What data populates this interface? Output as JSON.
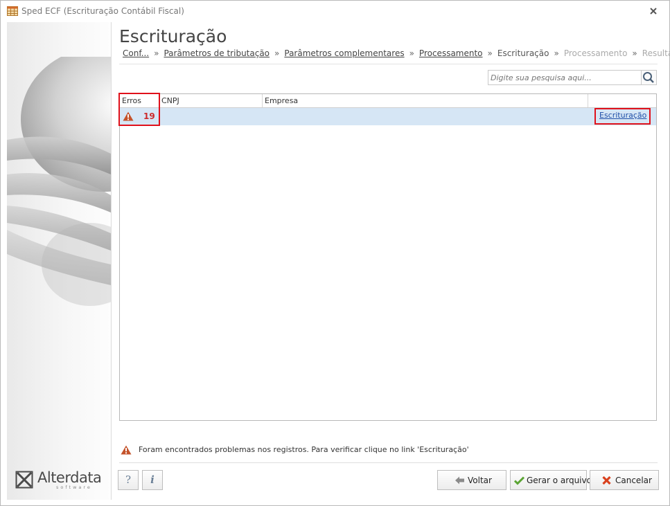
{
  "window": {
    "title": "Sped ECF (Escrituração Contábil Fiscal)"
  },
  "page": {
    "title": "Escrituração"
  },
  "breadcrumb": [
    {
      "label": "Conf...",
      "state": "link"
    },
    {
      "label": "Parâmetros de tributação",
      "state": "link"
    },
    {
      "label": "Parâmetros complementares",
      "state": "link"
    },
    {
      "label": "Processamento",
      "state": "link"
    },
    {
      "label": "Escrituração",
      "state": "current"
    },
    {
      "label": "Processamento",
      "state": "disabled"
    },
    {
      "label": "Resultado",
      "state": "disabled"
    }
  ],
  "breadcrumb_separator": "»",
  "search": {
    "placeholder": "Digite sua pesquisa aqui..."
  },
  "grid": {
    "columns": [
      "Erros",
      "CNPJ",
      "Empresa",
      ""
    ],
    "rows": [
      {
        "errors": "19",
        "cnpj": "",
        "empresa": "",
        "link": "Escrituração"
      }
    ]
  },
  "message": {
    "text": "Foram encontrados problemas nos registros. Para verificar clique no link 'Escrituração'"
  },
  "buttons": {
    "help": "?",
    "info": "i",
    "back": "Voltar",
    "generate": "Gerar o arquivo",
    "cancel": "Cancelar"
  },
  "logo": {
    "name": "Alterdata",
    "sub": "software"
  },
  "colors": {
    "row_selected": "#d6e6f5",
    "highlight": "#e0101a",
    "error": "#cc2a2a",
    "link": "#1f4fa8"
  }
}
